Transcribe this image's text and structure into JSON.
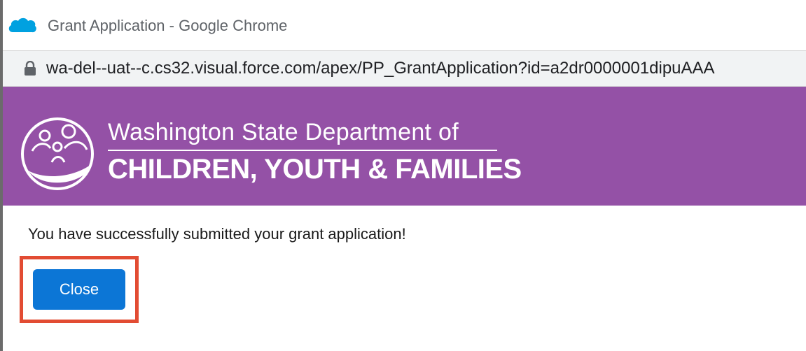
{
  "browser": {
    "window_title": "Grant Application - Google Chrome",
    "url": "wa-del--uat--c.cs32.visual.force.com/apex/PP_GrantApplication?id=a2dr0000001dipuAAA",
    "icons": {
      "app": "salesforce-cloud-icon",
      "security": "lock-icon"
    },
    "colors": {
      "app_icon": "#00a1e0"
    }
  },
  "header": {
    "department_line1": "Washington State Department of",
    "department_line2": "CHILDREN, YOUTH & FAMILIES",
    "logo_icon": "dcyf-family-logo-icon",
    "background_color": "#9451a6"
  },
  "content": {
    "message": "You have successfully submitted your grant application!",
    "close_label": "Close",
    "button_color": "#0c76d6",
    "highlight_color": "#e24c33"
  }
}
